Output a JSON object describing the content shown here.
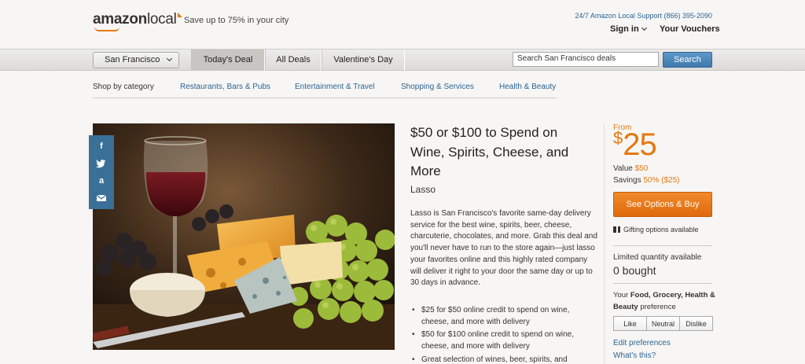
{
  "header": {
    "logo_word1": "amazon",
    "logo_word2": "local",
    "tagline": "Save up to 75% in your city",
    "support": "24/7 Amazon Local Support (866) 395-2090",
    "signin": "Sign in",
    "vouchers": "Your Vouchers"
  },
  "nav": {
    "city": "San Francisco",
    "tabs": [
      "Today's Deal",
      "All Deals",
      "Valentine's Day"
    ],
    "search_placeholder": "Search San Francisco deals",
    "search_button": "Search"
  },
  "categories": {
    "label": "Shop by category",
    "links": [
      "Restaurants, Bars & Pubs",
      "Entertainment & Travel",
      "Shopping & Services",
      "Health & Beauty"
    ]
  },
  "deal": {
    "title": "$50 or $100 to Spend on Wine, Spirits, Cheese, and More",
    "merchant": "Lasso",
    "description": "Lasso is San Francisco's favorite same-day delivery service for the best wine, spirits, beer, cheese, charcuterie, chocolates, and more. Grab this deal and you'll never have to run to the store again—just lasso your favorites online and this highly rated company will deliver it right to your door the same day or up to 30 days in advance.",
    "bullets": [
      "$25 for $50 online credit to spend on wine, cheese, and more with delivery",
      "$50 for $100 online credit to spend on wine, cheese, and more with delivery",
      "Great selection of wines, beer, spirits, and"
    ]
  },
  "buy": {
    "from": "From",
    "dollar": "$",
    "price": "25",
    "value_label": "Value",
    "value": "$50",
    "savings_label": "Savings",
    "savings": "50% ($25)",
    "button": "See Options & Buy",
    "gifting": "Gifting options available",
    "limited": "Limited quantity available",
    "bought": "0 bought",
    "pref_prefix": "Your",
    "pref_bold": "Food, Grocery, Health & Beauty",
    "pref_suffix": "preference",
    "pref_buttons": [
      "Like",
      "Neutral",
      "Dislike"
    ],
    "edit_preferences": "Edit preferences",
    "whats_this": "What's this?"
  },
  "share": {
    "icons": [
      "facebook-icon",
      "twitter-icon",
      "amazon-icon",
      "email-icon"
    ]
  },
  "colors": {
    "brand_orange": "#e47911",
    "link_blue": "#2a6496",
    "search_blue": "#4a86ba",
    "share_blue": "#3a6f97"
  }
}
